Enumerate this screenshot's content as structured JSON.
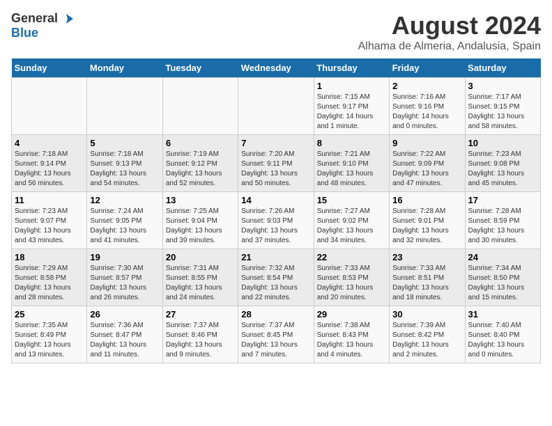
{
  "header": {
    "logo_general": "General",
    "logo_blue": "Blue",
    "title": "August 2024",
    "subtitle": "Alhama de Almeria, Andalusia, Spain"
  },
  "calendar": {
    "days_of_week": [
      "Sunday",
      "Monday",
      "Tuesday",
      "Wednesday",
      "Thursday",
      "Friday",
      "Saturday"
    ],
    "weeks": [
      [
        {
          "day": "",
          "info": ""
        },
        {
          "day": "",
          "info": ""
        },
        {
          "day": "",
          "info": ""
        },
        {
          "day": "",
          "info": ""
        },
        {
          "day": "1",
          "info": "Sunrise: 7:15 AM\nSunset: 9:17 PM\nDaylight: 14 hours\nand 1 minute."
        },
        {
          "day": "2",
          "info": "Sunrise: 7:16 AM\nSunset: 9:16 PM\nDaylight: 14 hours\nand 0 minutes."
        },
        {
          "day": "3",
          "info": "Sunrise: 7:17 AM\nSunset: 9:15 PM\nDaylight: 13 hours\nand 58 minutes."
        }
      ],
      [
        {
          "day": "4",
          "info": "Sunrise: 7:18 AM\nSunset: 9:14 PM\nDaylight: 13 hours\nand 56 minutes."
        },
        {
          "day": "5",
          "info": "Sunrise: 7:18 AM\nSunset: 9:13 PM\nDaylight: 13 hours\nand 54 minutes."
        },
        {
          "day": "6",
          "info": "Sunrise: 7:19 AM\nSunset: 9:12 PM\nDaylight: 13 hours\nand 52 minutes."
        },
        {
          "day": "7",
          "info": "Sunrise: 7:20 AM\nSunset: 9:11 PM\nDaylight: 13 hours\nand 50 minutes."
        },
        {
          "day": "8",
          "info": "Sunrise: 7:21 AM\nSunset: 9:10 PM\nDaylight: 13 hours\nand 48 minutes."
        },
        {
          "day": "9",
          "info": "Sunrise: 7:22 AM\nSunset: 9:09 PM\nDaylight: 13 hours\nand 47 minutes."
        },
        {
          "day": "10",
          "info": "Sunrise: 7:23 AM\nSunset: 9:08 PM\nDaylight: 13 hours\nand 45 minutes."
        }
      ],
      [
        {
          "day": "11",
          "info": "Sunrise: 7:23 AM\nSunset: 9:07 PM\nDaylight: 13 hours\nand 43 minutes."
        },
        {
          "day": "12",
          "info": "Sunrise: 7:24 AM\nSunset: 9:05 PM\nDaylight: 13 hours\nand 41 minutes."
        },
        {
          "day": "13",
          "info": "Sunrise: 7:25 AM\nSunset: 9:04 PM\nDaylight: 13 hours\nand 39 minutes."
        },
        {
          "day": "14",
          "info": "Sunrise: 7:26 AM\nSunset: 9:03 PM\nDaylight: 13 hours\nand 37 minutes."
        },
        {
          "day": "15",
          "info": "Sunrise: 7:27 AM\nSunset: 9:02 PM\nDaylight: 13 hours\nand 34 minutes."
        },
        {
          "day": "16",
          "info": "Sunrise: 7:28 AM\nSunset: 9:01 PM\nDaylight: 13 hours\nand 32 minutes."
        },
        {
          "day": "17",
          "info": "Sunrise: 7:28 AM\nSunset: 8:59 PM\nDaylight: 13 hours\nand 30 minutes."
        }
      ],
      [
        {
          "day": "18",
          "info": "Sunrise: 7:29 AM\nSunset: 8:58 PM\nDaylight: 13 hours\nand 28 minutes."
        },
        {
          "day": "19",
          "info": "Sunrise: 7:30 AM\nSunset: 8:57 PM\nDaylight: 13 hours\nand 26 minutes."
        },
        {
          "day": "20",
          "info": "Sunrise: 7:31 AM\nSunset: 8:55 PM\nDaylight: 13 hours\nand 24 minutes."
        },
        {
          "day": "21",
          "info": "Sunrise: 7:32 AM\nSunset: 8:54 PM\nDaylight: 13 hours\nand 22 minutes."
        },
        {
          "day": "22",
          "info": "Sunrise: 7:33 AM\nSunset: 8:53 PM\nDaylight: 13 hours\nand 20 minutes."
        },
        {
          "day": "23",
          "info": "Sunrise: 7:33 AM\nSunset: 8:51 PM\nDaylight: 13 hours\nand 18 minutes."
        },
        {
          "day": "24",
          "info": "Sunrise: 7:34 AM\nSunset: 8:50 PM\nDaylight: 13 hours\nand 15 minutes."
        }
      ],
      [
        {
          "day": "25",
          "info": "Sunrise: 7:35 AM\nSunset: 8:49 PM\nDaylight: 13 hours\nand 13 minutes."
        },
        {
          "day": "26",
          "info": "Sunrise: 7:36 AM\nSunset: 8:47 PM\nDaylight: 13 hours\nand 11 minutes."
        },
        {
          "day": "27",
          "info": "Sunrise: 7:37 AM\nSunset: 8:46 PM\nDaylight: 13 hours\nand 9 minutes."
        },
        {
          "day": "28",
          "info": "Sunrise: 7:37 AM\nSunset: 8:45 PM\nDaylight: 13 hours\nand 7 minutes."
        },
        {
          "day": "29",
          "info": "Sunrise: 7:38 AM\nSunset: 8:43 PM\nDaylight: 13 hours\nand 4 minutes."
        },
        {
          "day": "30",
          "info": "Sunrise: 7:39 AM\nSunset: 8:42 PM\nDaylight: 13 hours\nand 2 minutes."
        },
        {
          "day": "31",
          "info": "Sunrise: 7:40 AM\nSunset: 8:40 PM\nDaylight: 13 hours\nand 0 minutes."
        }
      ]
    ]
  }
}
